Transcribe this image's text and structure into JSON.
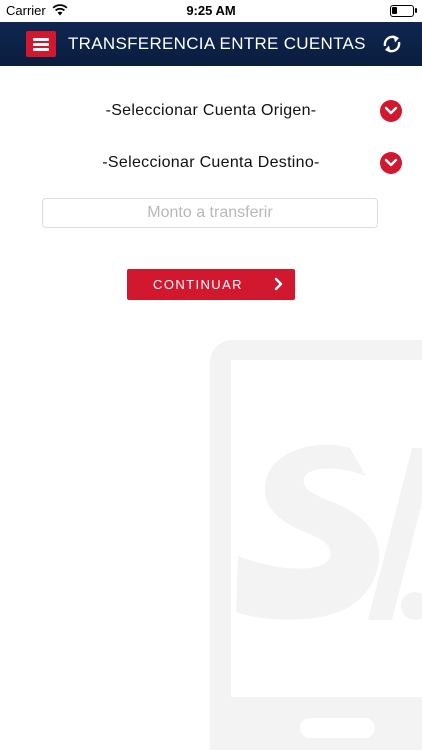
{
  "status_bar": {
    "carrier": "Carrier",
    "time": "9:25 AM",
    "battery_level": 0.25,
    "icons": [
      "wifi-icon",
      "battery-icon"
    ]
  },
  "header": {
    "title": "TRANSFERENCIA ENTRE CUENTAS",
    "menu_icon": "hamburger-menu-icon",
    "refresh_icon": "refresh-icon",
    "background_color": "#0b1f44"
  },
  "form": {
    "source_account": "-Seleccionar Cuenta Origen-",
    "destination_account": "-Seleccionar Cuenta Destino-",
    "dropdown_icon": "chevron-down-icon",
    "amount": {
      "value": "",
      "placeholder": "Monto a transferir"
    },
    "continue_label": "CONTINUAR",
    "continue_icon": "chevron-right-icon"
  },
  "colors": {
    "accent": "#d2182f",
    "header": "#0b1f44",
    "watermark": "#f3f3f3"
  },
  "background": {
    "watermark_icon": "phone-logo-watermark"
  }
}
